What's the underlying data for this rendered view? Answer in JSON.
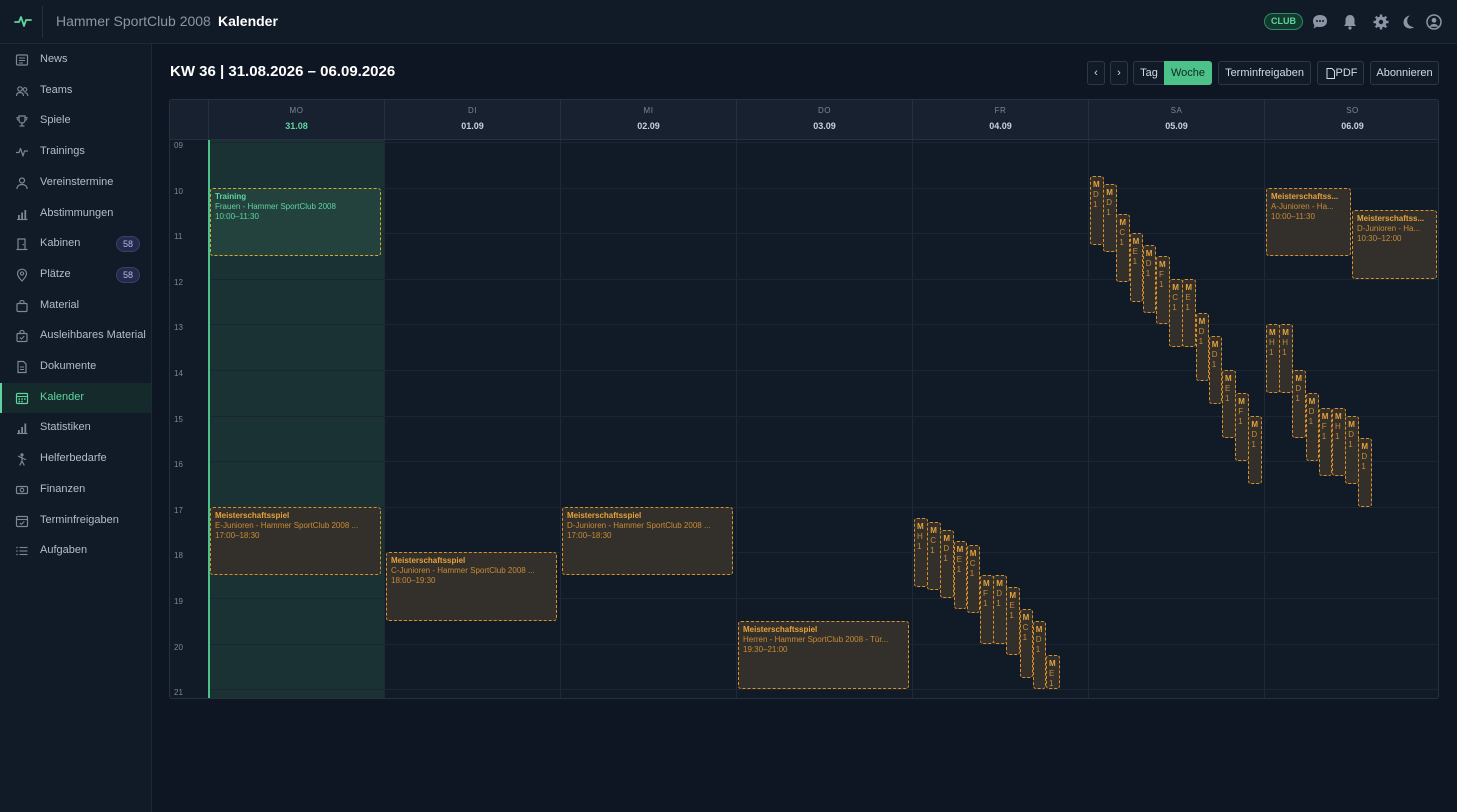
{
  "header": {
    "club": "Hammer SportClub 2008",
    "separator": "›",
    "page": "Kalender",
    "club_badge": "CLUB",
    "icons": [
      "chat-icon",
      "bell-icon",
      "gear-icon",
      "moon-icon",
      "user-icon"
    ]
  },
  "sidebar": {
    "items": [
      {
        "label": "News",
        "icon": "newspaper-icon"
      },
      {
        "label": "Teams",
        "icon": "users-icon"
      },
      {
        "label": "Spiele",
        "icon": "trophy-icon"
      },
      {
        "label": "Trainings",
        "icon": "activity-icon"
      },
      {
        "label": "Vereinstermine",
        "icon": "person-icon"
      },
      {
        "label": "Abstimmungen",
        "icon": "bar-chart-icon"
      },
      {
        "label": "Kabinen",
        "icon": "door-icon",
        "count": "58"
      },
      {
        "label": "Plätze",
        "icon": "map-pin-icon",
        "count": "58"
      },
      {
        "label": "Material",
        "icon": "bag-icon"
      },
      {
        "label": "Ausleihbares Material",
        "icon": "bag-check-icon"
      },
      {
        "label": "Dokumente",
        "icon": "document-icon"
      },
      {
        "label": "Kalender",
        "icon": "calendar-icon",
        "active": true
      },
      {
        "label": "Statistiken",
        "icon": "stats-icon"
      },
      {
        "label": "Helferbedarfe",
        "icon": "helper-icon"
      },
      {
        "label": "Finanzen",
        "icon": "money-icon"
      },
      {
        "label": "Terminfreigaben",
        "icon": "calendar-check-icon"
      },
      {
        "label": "Aufgaben",
        "icon": "list-icon"
      }
    ]
  },
  "toolbar": {
    "week_title": "KW 36 | 31.08.2026 – 06.09.2026",
    "prev": "‹",
    "next": "›",
    "day": "Tag",
    "week": "Woche",
    "approvals": "Terminfreigaben",
    "pdf": "PDF",
    "subscribe": "Abonnieren"
  },
  "calendar": {
    "days": [
      {
        "name": "MO",
        "date": "31.08",
        "today": true
      },
      {
        "name": "DI",
        "date": "01.09"
      },
      {
        "name": "MI",
        "date": "02.09"
      },
      {
        "name": "DO",
        "date": "03.09"
      },
      {
        "name": "FR",
        "date": "04.09"
      },
      {
        "name": "SA",
        "date": "05.09"
      },
      {
        "name": "SO",
        "date": "06.09"
      }
    ],
    "hours": [
      "09",
      "10",
      "11",
      "12",
      "13",
      "14",
      "15",
      "16",
      "17",
      "18",
      "19",
      "20",
      "21"
    ],
    "events": [
      {
        "day": 0,
        "start": 10.0,
        "end": 11.5,
        "lane": 0,
        "lanes": 1,
        "type": "training",
        "title": "Training",
        "team": "Frauen - Hammer SportClub 2008",
        "time": "10:00–11:30"
      },
      {
        "day": 0,
        "start": 17.0,
        "end": 18.5,
        "lane": 0,
        "lanes": 1,
        "type": "match",
        "title": "Meisterschaftsspiel",
        "team": "E-Junioren - Hammer SportClub 2008 ...",
        "time": "17:00–18:30"
      },
      {
        "day": 1,
        "start": 18.0,
        "end": 19.5,
        "lane": 0,
        "lanes": 1,
        "type": "match",
        "title": "Meisterschaftsspiel",
        "team": "C-Junioren - Hammer SportClub 2008 ...",
        "time": "18:00–19:30"
      },
      {
        "day": 2,
        "start": 17.0,
        "end": 18.5,
        "lane": 0,
        "lanes": 1,
        "type": "match",
        "title": "Meisterschaftsspiel",
        "team": "D-Junioren - Hammer SportClub 2008 ...",
        "time": "17:00–18:30"
      },
      {
        "day": 3,
        "start": 19.5,
        "end": 21.0,
        "lane": 0,
        "lanes": 1,
        "type": "match",
        "title": "Meisterschaftsspiel",
        "team": "Herren - Hammer SportClub 2008 - Tür...",
        "time": "19:30–21:00"
      },
      {
        "day": 6,
        "start": 10.0,
        "end": 11.5,
        "lane": 0,
        "lanes": 2,
        "type": "match",
        "title": "Meisterschaftss...",
        "team": "A-Junioren - Ha...",
        "time": "10:00–11:30"
      },
      {
        "day": 6,
        "start": 10.5,
        "end": 12.0,
        "lane": 1,
        "lanes": 2,
        "type": "match",
        "title": "Meisterschaftss...",
        "team": "D-Junioren - Ha...",
        "time": "10:30–12:00"
      },
      {
        "day": 4,
        "start": 17.25,
        "end": 18.75,
        "lane": 0,
        "lanes": 11,
        "type": "match",
        "title": "M",
        "team": "H",
        "time": "1"
      },
      {
        "day": 4,
        "start": 17.33,
        "end": 18.83,
        "lane": 1,
        "lanes": 11,
        "type": "match",
        "title": "M",
        "team": "C",
        "time": "1"
      },
      {
        "day": 4,
        "start": 17.5,
        "end": 19.0,
        "lane": 2,
        "lanes": 11,
        "type": "match",
        "title": "M",
        "team": "D",
        "time": "1"
      },
      {
        "day": 4,
        "start": 17.75,
        "end": 19.25,
        "lane": 3,
        "lanes": 11,
        "type": "match",
        "title": "M",
        "team": "E",
        "time": "1"
      },
      {
        "day": 4,
        "start": 17.83,
        "end": 19.33,
        "lane": 4,
        "lanes": 11,
        "type": "match",
        "title": "M",
        "team": "C",
        "time": "1"
      },
      {
        "day": 4,
        "start": 18.5,
        "end": 20.0,
        "lane": 5,
        "lanes": 11,
        "type": "match",
        "title": "M",
        "team": "F",
        "time": "1"
      },
      {
        "day": 4,
        "start": 18.5,
        "end": 20.0,
        "lane": 6,
        "lanes": 11,
        "type": "match",
        "title": "M",
        "team": "D",
        "time": "1"
      },
      {
        "day": 4,
        "start": 18.75,
        "end": 20.25,
        "lane": 7,
        "lanes": 11,
        "type": "match",
        "title": "M",
        "team": "E",
        "time": "1"
      },
      {
        "day": 4,
        "start": 19.25,
        "end": 20.75,
        "lane": 8,
        "lanes": 11,
        "type": "match",
        "title": "M",
        "team": "C",
        "time": "1"
      },
      {
        "day": 4,
        "start": 19.5,
        "end": 21.0,
        "lane": 9,
        "lanes": 11,
        "type": "match",
        "title": "M",
        "team": "D",
        "time": "1"
      },
      {
        "day": 4,
        "start": 20.25,
        "end": 21.0,
        "lane": 10,
        "lanes": 11,
        "type": "match",
        "title": "M",
        "team": "E",
        "time": "1"
      },
      {
        "day": 5,
        "start": 9.75,
        "end": 11.25,
        "lane": 0,
        "lanes": 13,
        "type": "match",
        "title": "M",
        "team": "D",
        "time": "1"
      },
      {
        "day": 5,
        "start": 9.92,
        "end": 11.42,
        "lane": 1,
        "lanes": 13,
        "type": "match",
        "title": "M",
        "team": "D",
        "time": "1"
      },
      {
        "day": 5,
        "start": 10.58,
        "end": 12.08,
        "lane": 2,
        "lanes": 13,
        "type": "match",
        "title": "M",
        "team": "C",
        "time": "1"
      },
      {
        "day": 5,
        "start": 11.0,
        "end": 12.5,
        "lane": 3,
        "lanes": 13,
        "type": "match",
        "title": "M",
        "team": "E",
        "time": "1"
      },
      {
        "day": 5,
        "start": 11.25,
        "end": 12.75,
        "lane": 4,
        "lanes": 13,
        "type": "match",
        "title": "M",
        "team": "D",
        "time": "1"
      },
      {
        "day": 5,
        "start": 11.5,
        "end": 13.0,
        "lane": 5,
        "lanes": 13,
        "type": "match",
        "title": "M",
        "team": "F",
        "time": "1"
      },
      {
        "day": 5,
        "start": 12.0,
        "end": 13.5,
        "lane": 6,
        "lanes": 13,
        "type": "match",
        "title": "M",
        "team": "C",
        "time": "1"
      },
      {
        "day": 5,
        "start": 12.0,
        "end": 13.5,
        "lane": 7,
        "lanes": 13,
        "type": "match",
        "title": "M",
        "team": "E",
        "time": "1"
      },
      {
        "day": 5,
        "start": 12.75,
        "end": 14.25,
        "lane": 8,
        "lanes": 13,
        "type": "match",
        "title": "M",
        "team": "D",
        "time": "1"
      },
      {
        "day": 5,
        "start": 13.25,
        "end": 14.75,
        "lane": 9,
        "lanes": 13,
        "type": "match",
        "title": "M",
        "team": "D",
        "time": "1"
      },
      {
        "day": 5,
        "start": 14.0,
        "end": 15.5,
        "lane": 10,
        "lanes": 13,
        "type": "match",
        "title": "M",
        "team": "E",
        "time": "1"
      },
      {
        "day": 5,
        "start": 14.5,
        "end": 16.0,
        "lane": 11,
        "lanes": 13,
        "type": "match",
        "title": "M",
        "team": "F",
        "time": "1"
      },
      {
        "day": 5,
        "start": 15.0,
        "end": 16.5,
        "lane": 12,
        "lanes": 13,
        "type": "match",
        "title": "M",
        "team": "D",
        "time": "1"
      },
      {
        "day": 6,
        "start": 13.0,
        "end": 14.5,
        "lane": 0,
        "lanes": 8,
        "type": "match",
        "title": "M",
        "team": "H",
        "time": "1"
      },
      {
        "day": 6,
        "start": 13.0,
        "end": 14.5,
        "lane": 1,
        "lanes": 8,
        "type": "match",
        "title": "M",
        "team": "H",
        "time": "1"
      },
      {
        "day": 6,
        "start": 14.0,
        "end": 15.5,
        "lane": 2,
        "lanes": 8,
        "type": "match",
        "title": "M",
        "team": "D",
        "time": "1"
      },
      {
        "day": 6,
        "start": 14.5,
        "end": 16.0,
        "lane": 3,
        "lanes": 8,
        "type": "match",
        "title": "M",
        "team": "D",
        "time": "1"
      },
      {
        "day": 6,
        "start": 14.83,
        "end": 16.33,
        "lane": 4,
        "lanes": 8,
        "type": "match",
        "title": "M",
        "team": "F",
        "time": "1"
      },
      {
        "day": 6,
        "start": 14.83,
        "end": 16.33,
        "lane": 5,
        "lanes": 8,
        "type": "match",
        "title": "M",
        "team": "H",
        "time": "1"
      },
      {
        "day": 6,
        "start": 15.0,
        "end": 16.5,
        "lane": 6,
        "lanes": 8,
        "type": "match",
        "title": "M",
        "team": "D",
        "time": "1"
      },
      {
        "day": 6,
        "start": 15.5,
        "end": 17.0,
        "lane": 7,
        "lanes": 8,
        "type": "match",
        "title": "M",
        "team": "D",
        "time": "1"
      }
    ]
  }
}
